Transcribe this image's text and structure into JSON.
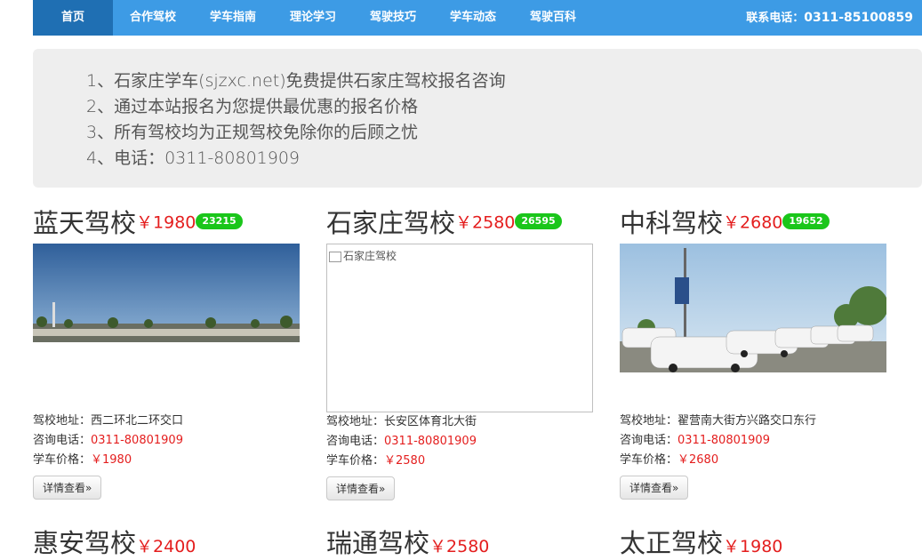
{
  "nav": {
    "items": [
      {
        "label": "首页"
      },
      {
        "label": "合作驾校"
      },
      {
        "label": "学车指南"
      },
      {
        "label": "理论学习"
      },
      {
        "label": "驾驶技巧"
      },
      {
        "label": "学车动态"
      },
      {
        "label": "驾驶百科"
      }
    ],
    "phone_label": "联系电话：",
    "phone_number": "0311-85100859"
  },
  "jumbotron": {
    "lines": [
      "1、石家庄学车(sjzxc.net)免费提供石家庄驾校报名咨询",
      "2、通过本站报名为您提供最优惠的报名价格",
      "3、所有驾校均为正规驾校免除你的后顾之忧",
      "4、电话：0311-80801909"
    ]
  },
  "labels": {
    "address": "驾校地址：",
    "phone": "咨询电话：",
    "price": "学车价格：",
    "detail_button": "详情查看»"
  },
  "schools": [
    {
      "name": "蓝天驾校",
      "price": "￥1980",
      "badge": "23215",
      "address": "西二环北二环交口",
      "phone": "0311-80801909",
      "price_text": "￥1980"
    },
    {
      "name": "石家庄驾校",
      "price": "￥2580",
      "badge": "26595",
      "address": "长安区体育北大街",
      "phone": "0311-80801909",
      "price_text": "￥2580",
      "img_alt": "石家庄驾校"
    },
    {
      "name": "中科驾校",
      "price": "￥2680",
      "badge": "19652",
      "address": "翟营南大街方兴路交口东行",
      "phone": "0311-80801909",
      "price_text": "￥2680"
    }
  ],
  "row2": [
    {
      "name": "惠安驾校",
      "price": "￥2400"
    },
    {
      "name": "瑞通驾校",
      "price": "￥2580"
    },
    {
      "name": "太正驾校",
      "price": "￥1980"
    }
  ],
  "colors": {
    "nav_bg": "#3d9be5",
    "nav_active": "#1f6fb3",
    "price_red": "#e41e1e",
    "badge_green": "#1ac61a"
  }
}
